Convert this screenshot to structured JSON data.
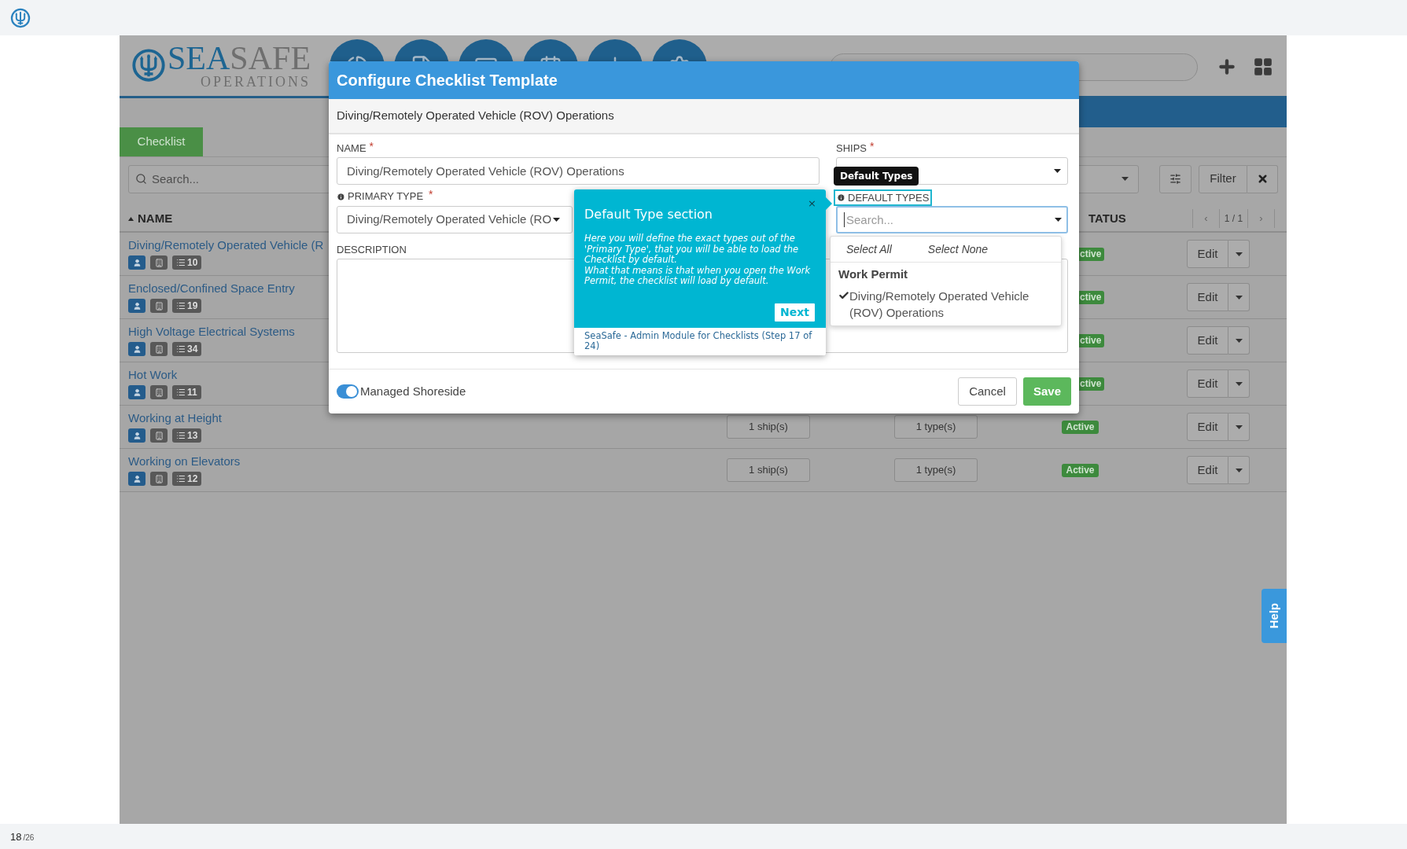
{
  "top_bar": {
    "page": "18",
    "page_total": "/26"
  },
  "app": {
    "brand": {
      "part_1": "SEA",
      "part_2": "SAFE",
      "tagline": "OPERATIONS"
    },
    "tabs": [
      {
        "label": "Checklist",
        "selected": true
      }
    ],
    "search": {
      "placeholder": "Search..."
    },
    "filter_button": "Filter",
    "table": {
      "columns": [
        "NAME",
        "TATUS"
      ],
      "pagination": "1 / 1",
      "prev": "‹",
      "next": "›",
      "rows": [
        {
          "kind": "covered",
          "name": "Diving/Remotely Operated Vehicle (R",
          "count": "10",
          "status": "ctive",
          "action": "Edit"
        },
        {
          "kind": "covered",
          "name": "Enclosed/Confined Space Entry",
          "count": "19",
          "status": "ctive",
          "action": "Edit"
        },
        {
          "kind": "covered",
          "name": "High Voltage Electrical Systems",
          "count": "34",
          "status": "ctive",
          "action": "Edit"
        },
        {
          "kind": "covered",
          "name": "Hot Work",
          "count": "11",
          "status": "ctive",
          "action": "Edit"
        },
        {
          "kind": "full",
          "name": "Working at Height",
          "count": "13",
          "ships": "1 ship(s)",
          "types": "1 type(s)",
          "status": "Active",
          "action": "Edit"
        },
        {
          "kind": "full",
          "name": "Working on Elevators",
          "count": "12",
          "ships": "1 ship(s)",
          "types": "1 type(s)",
          "status": "Active",
          "action": "Edit"
        }
      ]
    },
    "help_tab": "Help"
  },
  "modal": {
    "title": "Configure Checklist Template",
    "subtitle": "Diving/Remotely Operated Vehicle (ROV) Operations",
    "name_label": "NAME",
    "name_value": "Diving/Remotely Operated Vehicle (ROV) Operations",
    "ships_label": "SHIPS",
    "primary_type_label": "PRIMARY TYPE",
    "primary_type_value": "Diving/Remotely Operated Vehicle (RO",
    "description_label": "DESCRIPTION",
    "default_types_label": "DEFAULT TYPES",
    "default_types_placeholder": "Search...",
    "required_mark": "*",
    "toggle": {
      "label": "Managed Shoreside",
      "on": true
    },
    "buttons": [
      "Cancel",
      "Save"
    ]
  },
  "tooltip": "Default Types",
  "dropdown": {
    "actions": [
      "Select All",
      "Select None"
    ],
    "groups": [
      {
        "label": "Work Permit",
        "options": [
          {
            "label": "Diving/Remotely Operated Vehicle (ROV) Operations",
            "checked": true
          }
        ]
      }
    ]
  },
  "tour": {
    "close": "×",
    "title": "Default Type section",
    "body": [
      "Here you will define the exact types out of the 'Primary Type', that you will be able to load the Checklist by default.",
      "What that means is that when you open the Work Permit, the checklist will load by default."
    ],
    "next": "Next",
    "footer": "SeaSafe - Admin Module for Checklists (Step 17 of 24)"
  }
}
